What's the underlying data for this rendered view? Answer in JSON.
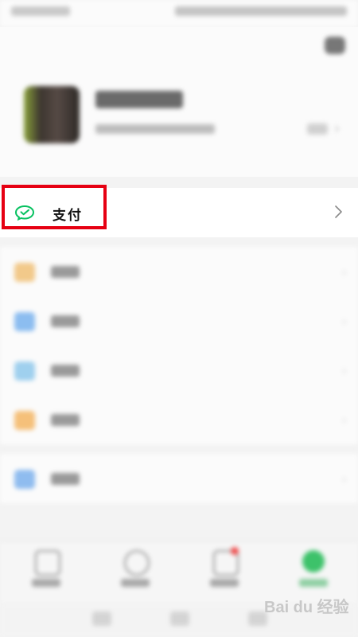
{
  "pay_row": {
    "label": "支付",
    "icon": "wechat-pay-icon",
    "accent_color": "#07c160",
    "highlight_color": "#e60012"
  },
  "watermark": {
    "text": "Bai du 经验"
  },
  "menu_icons": [
    "favorites-icon",
    "moments-icon",
    "cards-icon",
    "stickers-icon"
  ],
  "settings_icon": "settings-icon",
  "tab_icons": [
    "chats-icon",
    "contacts-icon",
    "discover-icon",
    "me-icon"
  ]
}
